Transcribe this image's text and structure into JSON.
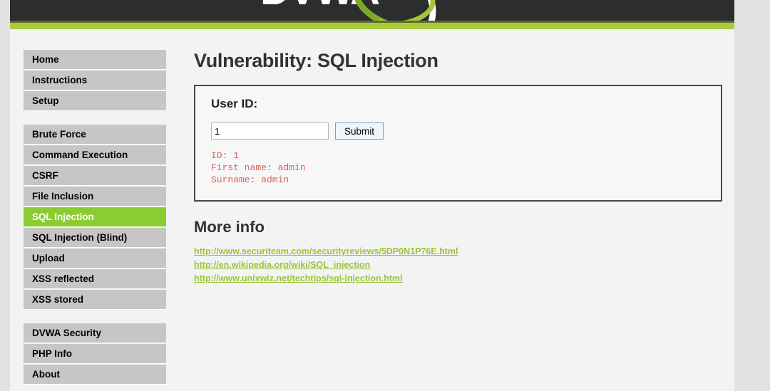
{
  "header": {
    "logo_text": "DVWA",
    "logo_alt": "dvwa-logo",
    "accent_dark_color": "#5c6b28",
    "accent_green_color": "#a9cc3d",
    "header_bg_color": "#2d2d2d"
  },
  "sidebar": {
    "groups": [
      {
        "items": [
          {
            "label": "Home",
            "selected": false
          },
          {
            "label": "Instructions",
            "selected": false
          },
          {
            "label": "Setup",
            "selected": false
          }
        ]
      },
      {
        "items": [
          {
            "label": "Brute Force",
            "selected": false
          },
          {
            "label": "Command Execution",
            "selected": false
          },
          {
            "label": "CSRF",
            "selected": false
          },
          {
            "label": "File Inclusion",
            "selected": false
          },
          {
            "label": "SQL Injection",
            "selected": true
          },
          {
            "label": "SQL Injection (Blind)",
            "selected": false
          },
          {
            "label": "Upload",
            "selected": false
          },
          {
            "label": "XSS reflected",
            "selected": false
          },
          {
            "label": "XSS stored",
            "selected": false
          }
        ]
      },
      {
        "items": [
          {
            "label": "DVWA Security",
            "selected": false
          },
          {
            "label": "PHP Info",
            "selected": false
          },
          {
            "label": "About",
            "selected": false
          }
        ]
      }
    ],
    "selected_bg_color": "#8ccc33",
    "item_bg_color": "#c6c6c6"
  },
  "main": {
    "page_title": "Vulnerability: SQL Injection",
    "vuln_box": {
      "box_title": "User ID:",
      "input_value": "1",
      "input_placeholder": "",
      "submit_label": "Submit",
      "result_text": "ID: 1\nFirst name: admin\nSurname: admin",
      "result_color": "#e05c5c"
    },
    "more_info": {
      "heading": "More info",
      "links": [
        "http://www.securiteam.com/securityreviews/5DP0N1P76E.html",
        "http://en.wikipedia.org/wiki/SQL_injection",
        "http://www.unixwiz.net/techtips/sql-injection.html"
      ],
      "link_color": "#9dc43a"
    }
  }
}
